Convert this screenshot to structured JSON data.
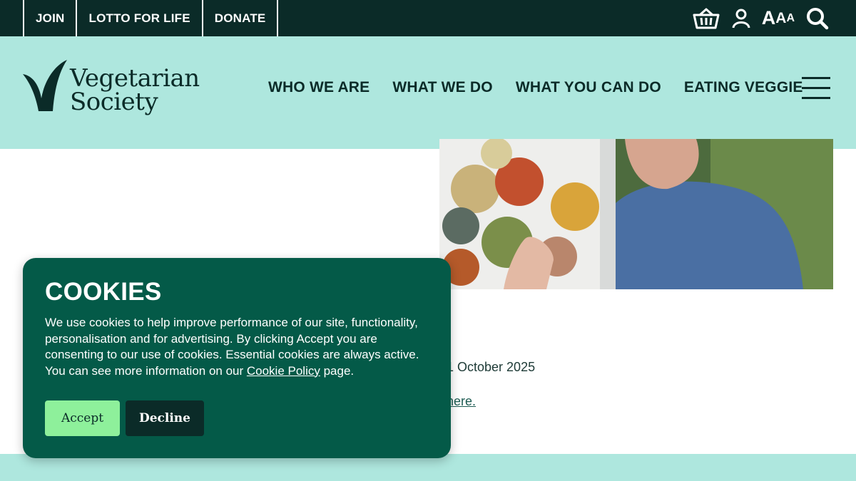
{
  "topbar": {
    "links": [
      "JOIN",
      "LOTTO FOR LIFE",
      "DONATE"
    ],
    "tools": {
      "basket_icon": "basket-icon",
      "account_icon": "user-icon",
      "text_size_label": [
        "A",
        "A",
        "A"
      ],
      "search_icon": "search-icon"
    }
  },
  "header": {
    "logo_line1": "Vegetarian",
    "logo_line2": "Society",
    "nav": [
      "WHO WE ARE",
      "WHAT WE DO",
      "WHAT YOU CAN DO",
      "EATING VEGGIE"
    ],
    "menu_icon": "hamburger-menu-icon"
  },
  "content": {
    "date_text": "1 October 2025",
    "link_text": "here."
  },
  "cookie": {
    "title": "COOKIES",
    "text_before": "We use cookies to help improve performance of our site, functionality, personalisation and for advertising. By clicking Accept you are consenting to our use of cookies. Essential cookies are always active. You can see more information on our ",
    "policy_link": "Cookie Policy",
    "text_after": " page.",
    "accept_label": "Accept",
    "decline_label": "Decline"
  },
  "colors": {
    "topbar": "#0b2b28",
    "header": "#aee7de",
    "cookie_bg": "#045a48",
    "accept": "#8ef09b"
  }
}
